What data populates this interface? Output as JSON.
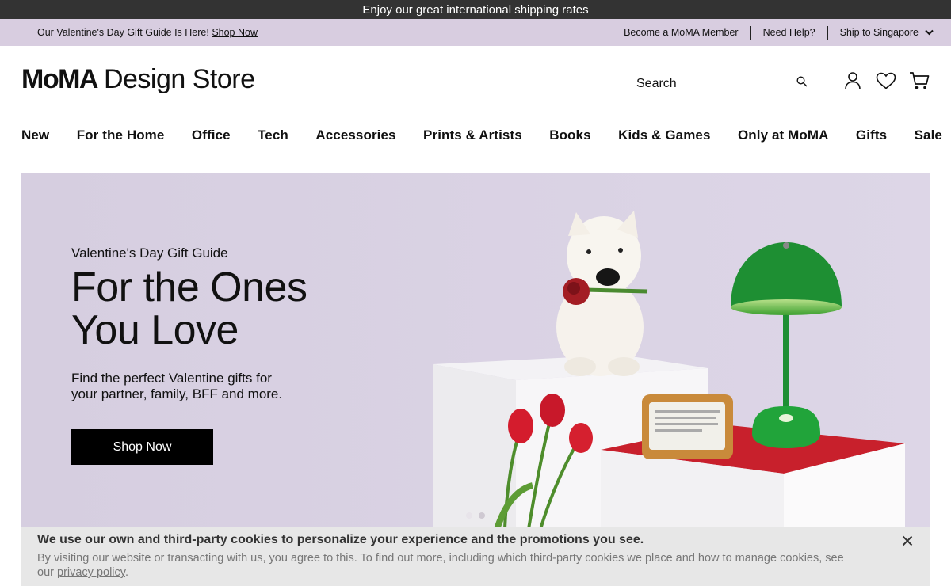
{
  "banner": {
    "text": "Enjoy our great international shipping rates"
  },
  "promo": {
    "text": "Our Valentine's Day Gift Guide Is Here!",
    "link": "Shop Now",
    "member": "Become a MoMA Member",
    "help": "Need Help?",
    "ship": "Ship to Singapore"
  },
  "header": {
    "logo_bold": "MoMA",
    "logo_rest": "Design Store",
    "search_placeholder": "Search"
  },
  "nav": {
    "items": [
      "New",
      "For the Home",
      "Office",
      "Tech",
      "Accessories",
      "Prints & Artists",
      "Books",
      "Kids & Games",
      "Only at MoMA",
      "Gifts",
      "Sale"
    ]
  },
  "hero": {
    "eyebrow": "Valentine's Day Gift Guide",
    "title": "For the Ones You Love",
    "subtitle": "Find the perfect Valentine gifts for your partner, family, BFF and more.",
    "cta": "Shop Now",
    "background": "#d9d1e3",
    "slides": 2,
    "active_slide": 2
  },
  "cookie": {
    "title": "We use our own and third-party cookies to personalize your experience and the promotions you see.",
    "body": "By visiting our website or transacting with us, you agree to this. To find out more, including which third-party cookies we place and how to manage cookies, see our",
    "link": "privacy policy",
    "period": "."
  },
  "colors": {
    "banner": "#333333",
    "promo": "#d8cde0",
    "accent_green": "#1f9a3a",
    "accent_red": "#c8202c"
  }
}
